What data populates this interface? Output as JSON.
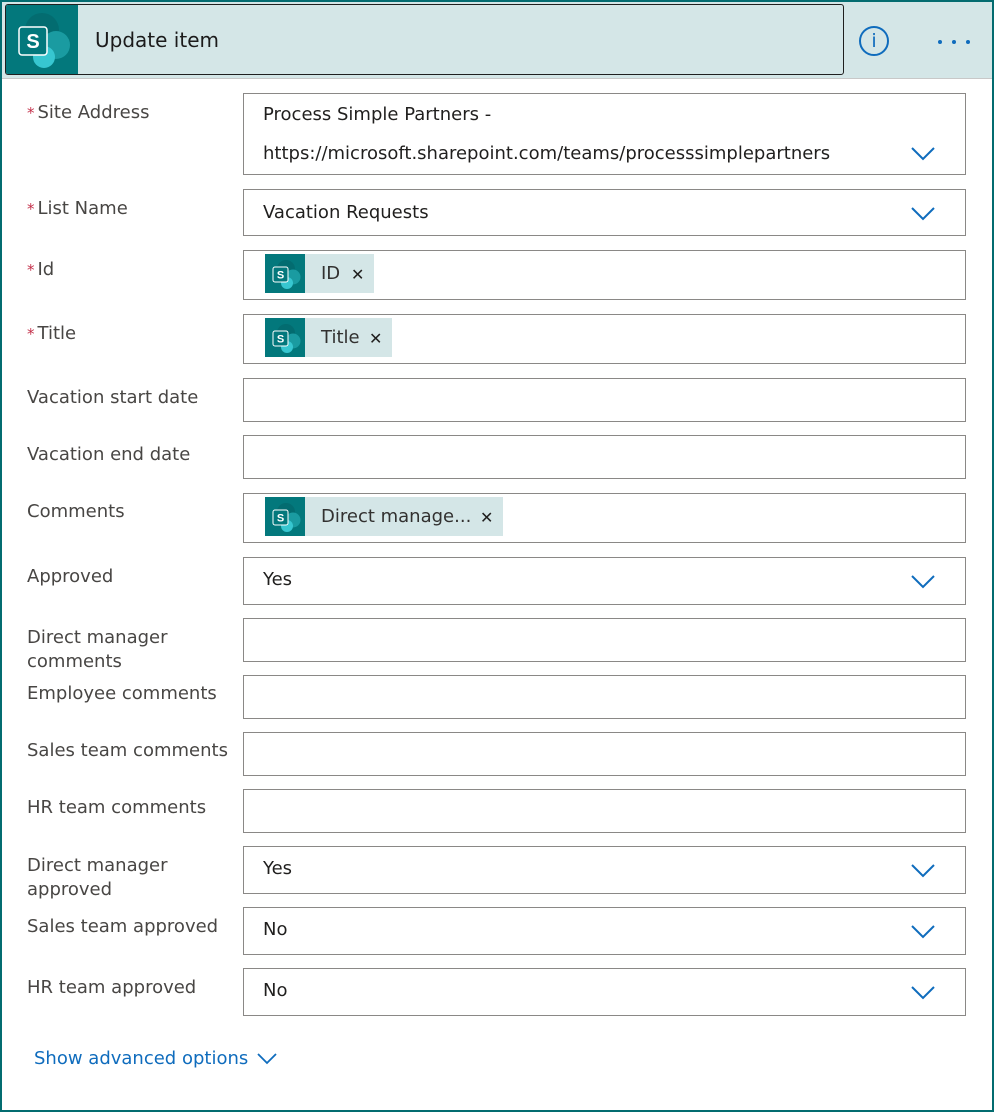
{
  "header": {
    "title": "Update item"
  },
  "fields": {
    "site_address": {
      "label": "Site Address",
      "line1": "Process Simple Partners -",
      "line2": "https://microsoft.sharepoint.com/teams/processsimplepartners"
    },
    "list_name": {
      "label": "List Name",
      "value": "Vacation Requests"
    },
    "id": {
      "label": "Id",
      "token": "ID"
    },
    "title": {
      "label": "Title",
      "token": "Title"
    },
    "vacation_start": {
      "label": "Vacation start date",
      "value": ""
    },
    "vacation_end": {
      "label": "Vacation end date",
      "value": ""
    },
    "comments": {
      "label": "Comments",
      "token": "Direct manage..."
    },
    "approved": {
      "label": "Approved",
      "value": "Yes"
    },
    "direct_manager_comments": {
      "label_line1": "Direct manager",
      "label_line2": "comments",
      "value": ""
    },
    "employee_comments": {
      "label": "Employee comments",
      "value": ""
    },
    "sales_team_comments": {
      "label": "Sales team comments",
      "value": ""
    },
    "hr_team_comments": {
      "label": "HR team comments",
      "value": ""
    },
    "direct_manager_approved": {
      "label_line1": "Direct manager",
      "label_line2": "approved",
      "value": "Yes"
    },
    "sales_team_approved": {
      "label": "Sales team approved",
      "value": "No"
    },
    "hr_team_approved": {
      "label": "HR team approved",
      "value": "No"
    }
  },
  "footer": {
    "advanced_label": "Show advanced options"
  },
  "icons": {
    "header_icon": "sharepoint-icon",
    "token_icon": "sharepoint-icon",
    "info": "info-icon",
    "more": "more-icon",
    "dropdown": "chevron-down-icon",
    "remove": "close-icon"
  },
  "colors": {
    "accent": "#0f6cbd",
    "sharepoint_teal": "#03787c",
    "header_bg": "#d4e6e7",
    "required": "#c4314b"
  }
}
